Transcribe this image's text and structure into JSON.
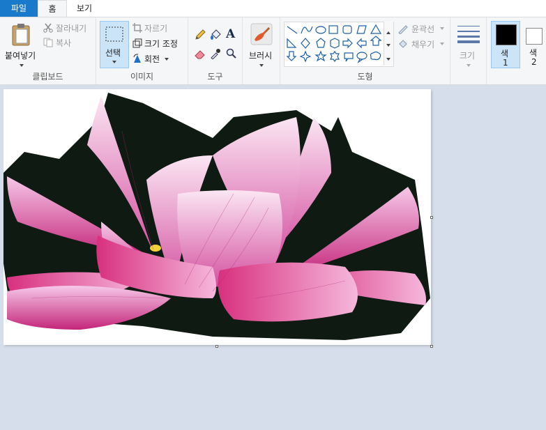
{
  "tabs": {
    "file": "파일",
    "home": "홈",
    "view": "보기"
  },
  "clipboard": {
    "paste": "붙여넣기",
    "cut": "잘라내기",
    "copy": "복사",
    "group": "클립보드"
  },
  "image": {
    "select": "선택",
    "crop": "자르기",
    "resize": "크기 조정",
    "rotate": "회전",
    "group": "이미지"
  },
  "tools": {
    "group": "도구"
  },
  "brushes": {
    "label": "브러시"
  },
  "shapes": {
    "outline": "윤곽선",
    "fill": "채우기",
    "group": "도형"
  },
  "size": {
    "label": "크기"
  },
  "colors": {
    "color1": "색",
    "color1_num": "1",
    "color2": "색",
    "color2_num": "2",
    "accent": "#1979ca"
  }
}
